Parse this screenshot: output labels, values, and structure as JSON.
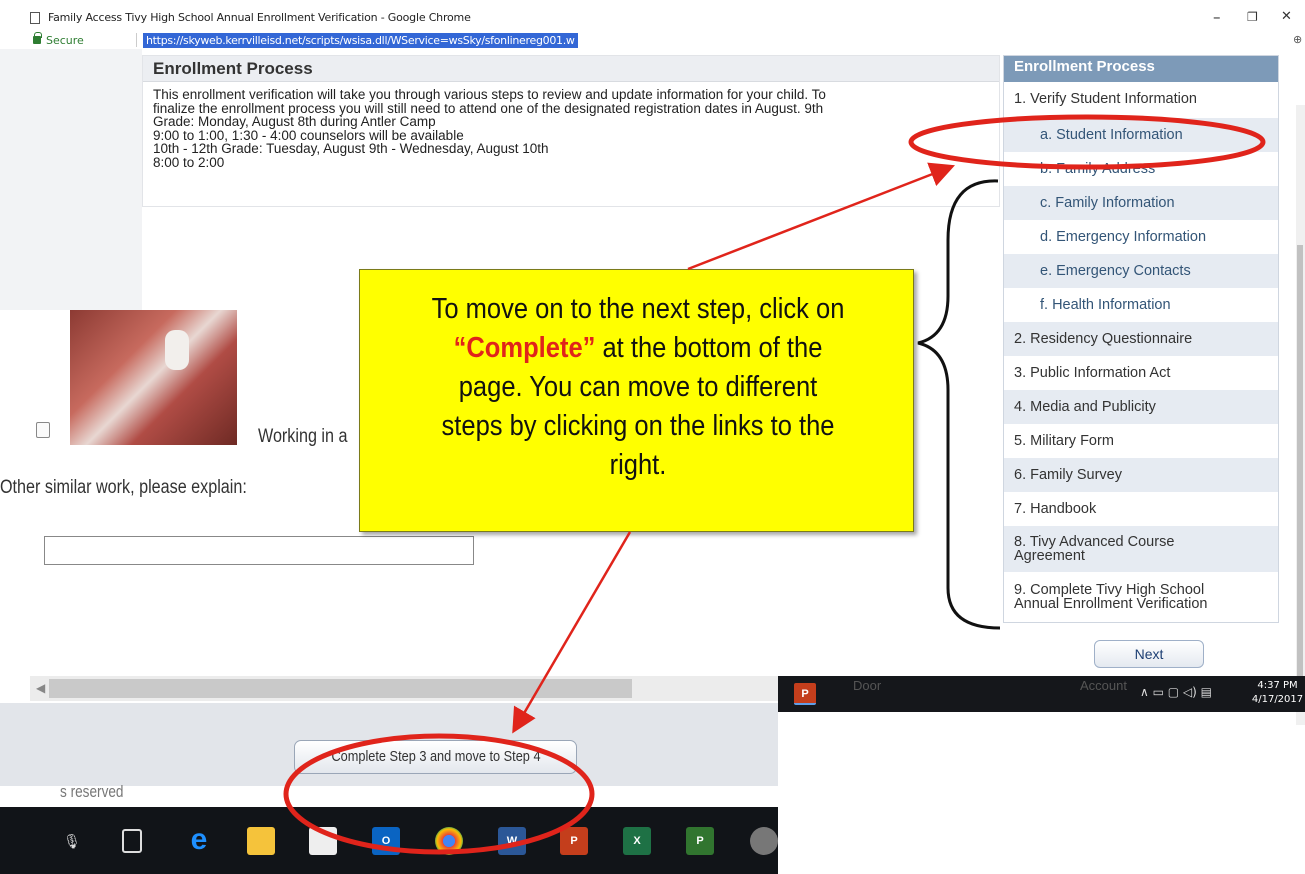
{
  "window": {
    "title": "Family Access Tivy High School Annual Enrollment Verification - Google Chrome",
    "minimize": "–",
    "restore": "❐",
    "close": "✕"
  },
  "address_bar": {
    "secure_label": "Secure",
    "url": "https://skyweb.kerrvilleisd.net/scripts/wsisa.dll/WService=wsSky/sfonlinereg001.w"
  },
  "enrollment": {
    "title": "Enrollment Process",
    "lines": [
      "This enrollment verification will take you through various steps to review and update information for your child. To",
      "finalize the enrollment process you will still need to attend one of the designated registration dates in August. 9th",
      "Grade: Monday, August 8th during Antler Camp",
      "9:00 to 1:00, 1:30 - 4:00 counselors will be available",
      "10th - 12th Grade: Tuesday, August 9th - Wednesday, August 10th",
      "8:00 to 2:00"
    ]
  },
  "sidebar": {
    "header": "Enrollment Process",
    "items": [
      {
        "label": "1. Verify Student Information"
      },
      {
        "label": "a. Student Information"
      },
      {
        "label": "b. Family Address"
      },
      {
        "label": "c. Family Information"
      },
      {
        "label": "d. Emergency Information"
      },
      {
        "label": "e. Emergency Contacts"
      },
      {
        "label": "f. Health Information"
      },
      {
        "label": "2. Residency Questionnaire"
      },
      {
        "label": "3. Public Information Act"
      },
      {
        "label": "4. Media and Publicity"
      },
      {
        "label": "5. Military Form"
      },
      {
        "label": "6. Family Survey"
      },
      {
        "label": "7. Handbook"
      },
      {
        "label": "8. Tivy Advanced Course Agreement"
      },
      {
        "label": "9. Complete Tivy High School Annual Enrollment Verification"
      }
    ],
    "next_label": "Next"
  },
  "step_page": {
    "working_text": "Working in a",
    "other_label": "Other similar work, please explain:",
    "other_value": "",
    "complete_button": "Complete Step 3 and move to Step 4",
    "footer_text": "s reserved"
  },
  "callout": {
    "line1": "To move on to the next step, click on",
    "highlight": "“Complete”",
    "line2_rest": " at the bottom of the",
    "line3": "page.  You can move to different",
    "line4": "steps by clicking on the links to the",
    "line5": "right."
  },
  "taskbar_right": {
    "ghost1": "Door",
    "ghost2": "Account",
    "time": "4:37 PM",
    "date": "4/17/2017"
  },
  "colors": {
    "annotation_red": "#e0241b",
    "callout_yellow": "#ffff00",
    "sidebar_header": "#7d9ab8",
    "url_highlight": "#3367d6"
  }
}
